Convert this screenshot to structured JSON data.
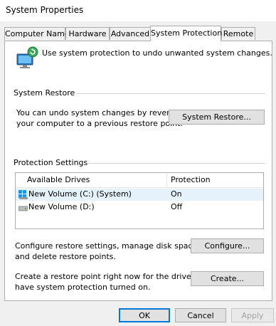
{
  "window": {
    "title": "System Properties"
  },
  "tabs": [
    {
      "label": "Computer Name"
    },
    {
      "label": "Hardware"
    },
    {
      "label": "Advanced"
    },
    {
      "label": "System Protection"
    },
    {
      "label": "Remote"
    }
  ],
  "active_tab": "System Protection",
  "intro_text": "Use system protection to undo unwanted system changes.",
  "system_restore": {
    "heading": "System Restore",
    "description_line1": "You can undo system changes by reverting",
    "description_line2": "your computer to a previous restore point.",
    "button_label": "System Restore..."
  },
  "protection_settings": {
    "heading": "Protection Settings",
    "columns": [
      "Available Drives",
      "Protection"
    ],
    "drives": [
      {
        "name": "New Volume (C:) (System)",
        "protection": "On",
        "icon": "windows-drive-icon",
        "selected": true
      },
      {
        "name": "New Volume (D:)",
        "protection": "Off",
        "icon": "drive-icon",
        "selected": false
      }
    ]
  },
  "configure": {
    "description_line1": "Configure restore settings, manage disk space,",
    "description_line2": "and delete restore points.",
    "button_label": "Configure..."
  },
  "create": {
    "description_line1": "Create a restore point right now for the drives that",
    "description_line2": "have system protection turned on.",
    "button_label": "Create..."
  },
  "dialog_buttons": {
    "ok": "OK",
    "cancel": "Cancel",
    "apply": "Apply"
  },
  "colors": {
    "window_bg": "#f0f0f0",
    "panel_bg": "#ffffff",
    "accent": "#0078d7",
    "selection": "#e5f1fb"
  }
}
